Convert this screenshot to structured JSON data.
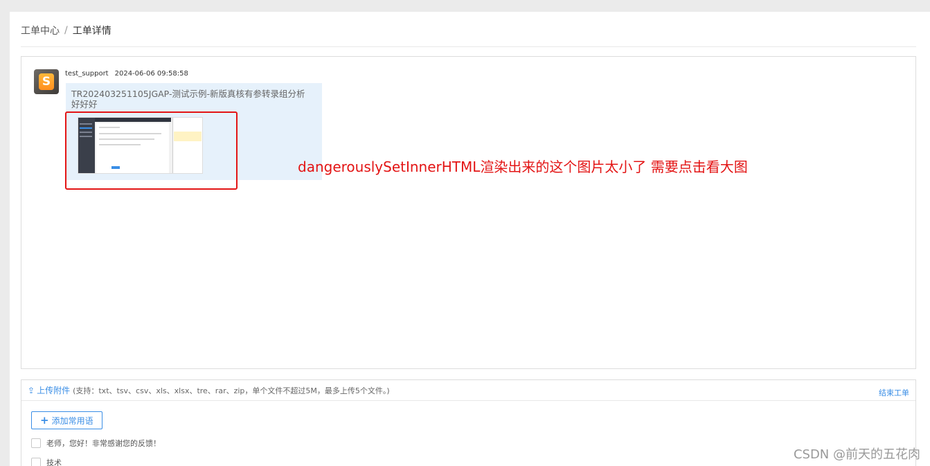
{
  "breadcrumb": {
    "parent": "工单中心",
    "separator": "/",
    "current": "工单详情"
  },
  "message": {
    "avatar_letter": "S",
    "username": "test_support",
    "timestamp": "2024-06-06 09:58:58",
    "text": "TR202403251105JGAP-测试示例-新版真核有参转录组分析好好好"
  },
  "annotation": {
    "text": "dangerouslySetInnerHTML渲染出来的这个图片太小了 需要点击看大图",
    "color": "#e31414"
  },
  "reply": {
    "upload_label": "上传附件",
    "upload_icon": "upload-icon",
    "upload_hint": "(支持：txt、tsv、csv、xls、xlsx、tre、rar、zip，单个文件不超过5M，最多上传5个文件。)",
    "finish_label": "结束工单",
    "add_phrase_label": "添加常用语",
    "phrases": [
      "老师，您好！非常感谢您的反馈！",
      "技术"
    ]
  },
  "watermark": "CSDN @前天的五花肉",
  "colors": {
    "accent": "#3a8ee6",
    "bubble": "#e6f1fb",
    "annotation_red": "#e31414"
  }
}
